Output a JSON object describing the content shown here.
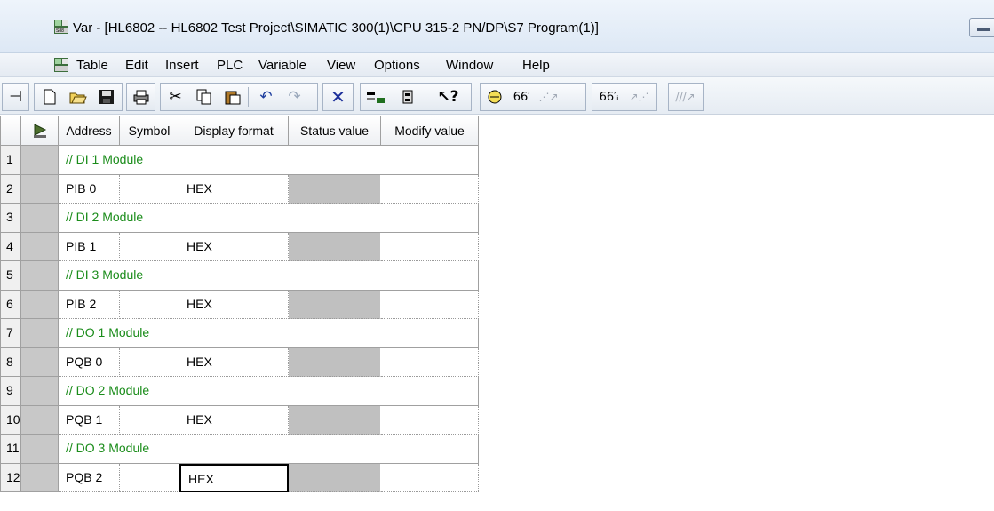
{
  "window": {
    "title": "Var - [HL6802 -- HL6802 Test Project\\SIMATIC 300(1)\\CPU 315-2 PN/DP\\S7 Program(1)]",
    "app_icon": "variable-table-icon",
    "minimize_icon": "minimize-icon"
  },
  "menubar": {
    "items": [
      {
        "label": "Table"
      },
      {
        "label": "Edit"
      },
      {
        "label": "Insert"
      },
      {
        "label": "PLC"
      },
      {
        "label": "Variable"
      },
      {
        "label": "View"
      },
      {
        "label": "Options"
      },
      {
        "label": "Window"
      },
      {
        "label": "Help"
      }
    ]
  },
  "toolbar": {
    "buttons": [
      "pin-icon",
      "new-icon",
      "open-icon",
      "save-icon",
      "print-icon",
      "cut-icon",
      "copy-icon",
      "paste-icon",
      "undo-icon",
      "redo-icon",
      "delete-icon",
      "monitor-variable-icon",
      "modify-variable-icon",
      "help-icon",
      "connect-icon",
      "monitor-icon",
      "monitor-disabled-icon",
      "modify-icon",
      "modify-disabled-icon",
      "force-icon"
    ]
  },
  "table": {
    "headers": [
      "Address",
      "Symbol",
      "Display format",
      "Status value",
      "Modify value"
    ],
    "rows": [
      {
        "num": "1",
        "comment": "// DI 1  Module"
      },
      {
        "num": "2",
        "address": "PIB   0",
        "symbol": "",
        "format": "HEX"
      },
      {
        "num": "3",
        "comment": "// DI 2  Module"
      },
      {
        "num": "4",
        "address": "PIB   1",
        "symbol": "",
        "format": "HEX"
      },
      {
        "num": "5",
        "comment": "// DI 3  Module"
      },
      {
        "num": "6",
        "address": "PIB   2",
        "symbol": "",
        "format": "HEX"
      },
      {
        "num": "7",
        "comment": "// DO 1  Module"
      },
      {
        "num": "8",
        "address": "PQB   0",
        "symbol": "",
        "format": "HEX"
      },
      {
        "num": "9",
        "comment": "// DO 2  Module"
      },
      {
        "num": "10",
        "address": "PQB   1",
        "symbol": "",
        "format": "HEX"
      },
      {
        "num": "11",
        "comment": "// DO 3  Module"
      },
      {
        "num": "12",
        "address": "PQB   2",
        "symbol": "",
        "format": "HEX",
        "selected": true
      }
    ]
  },
  "colors": {
    "comment_text": "#1a8c1a",
    "status_cell": "#c0c0c0"
  }
}
